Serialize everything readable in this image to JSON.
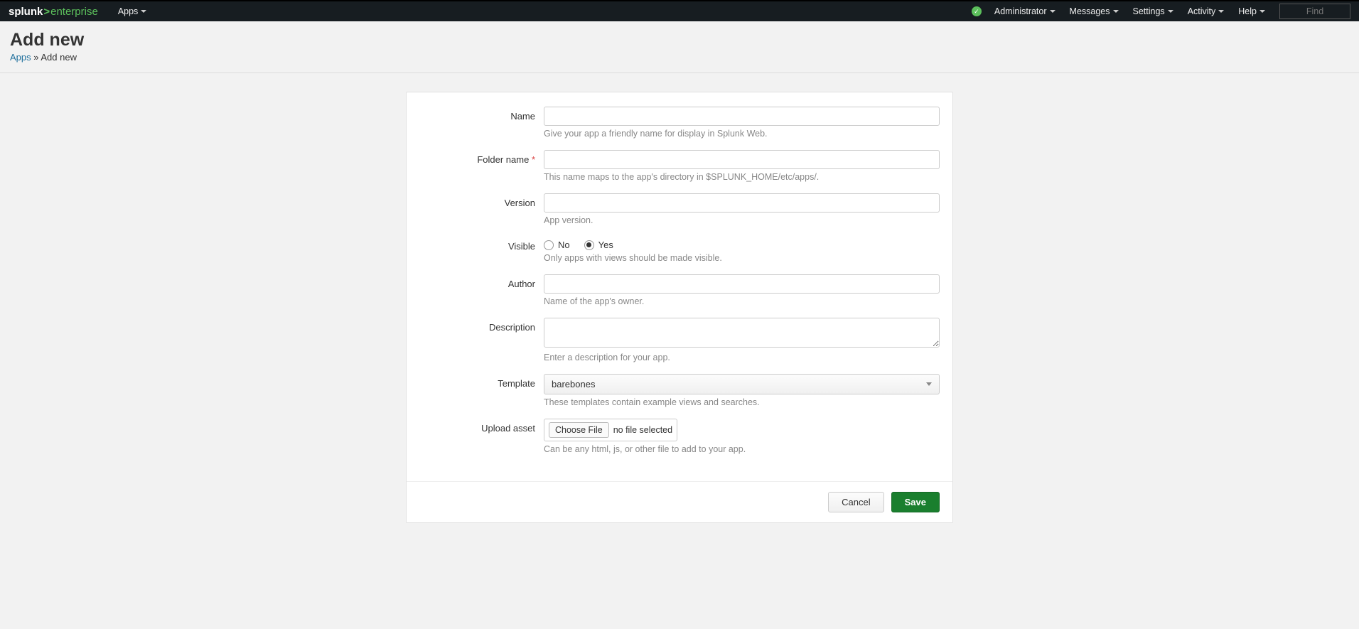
{
  "topbar": {
    "logo": {
      "splunk": "splunk",
      "enterprise": "enterprise"
    },
    "apps_label": "Apps",
    "right": {
      "administrator": "Administrator",
      "messages": "Messages",
      "settings": "Settings",
      "activity": "Activity",
      "help": "Help",
      "find": "Find"
    }
  },
  "header": {
    "title": "Add new",
    "breadcrumb_root": "Apps",
    "breadcrumb_sep": " » ",
    "breadcrumb_current": "Add new"
  },
  "form": {
    "name": {
      "label": "Name",
      "value": "",
      "help": "Give your app a friendly name for display in Splunk Web."
    },
    "folder": {
      "label": "Folder name",
      "required": "*",
      "value": "",
      "help": "This name maps to the app's directory in $SPLUNK_HOME/etc/apps/."
    },
    "version": {
      "label": "Version",
      "value": "",
      "help": "App version."
    },
    "visible": {
      "label": "Visible",
      "option_no": "No",
      "option_yes": "Yes",
      "selected": "Yes",
      "help": "Only apps with views should be made visible."
    },
    "author": {
      "label": "Author",
      "value": "",
      "help": "Name of the app's owner."
    },
    "description": {
      "label": "Description",
      "value": "",
      "help": "Enter a description for your app."
    },
    "template": {
      "label": "Template",
      "selected": "barebones",
      "help": "These templates contain example views and searches."
    },
    "upload": {
      "label": "Upload asset",
      "choose_label": "Choose File",
      "file_status": "no file selected",
      "help": "Can be any html, js, or other file to add to your app."
    }
  },
  "footer": {
    "cancel": "Cancel",
    "save": "Save"
  }
}
